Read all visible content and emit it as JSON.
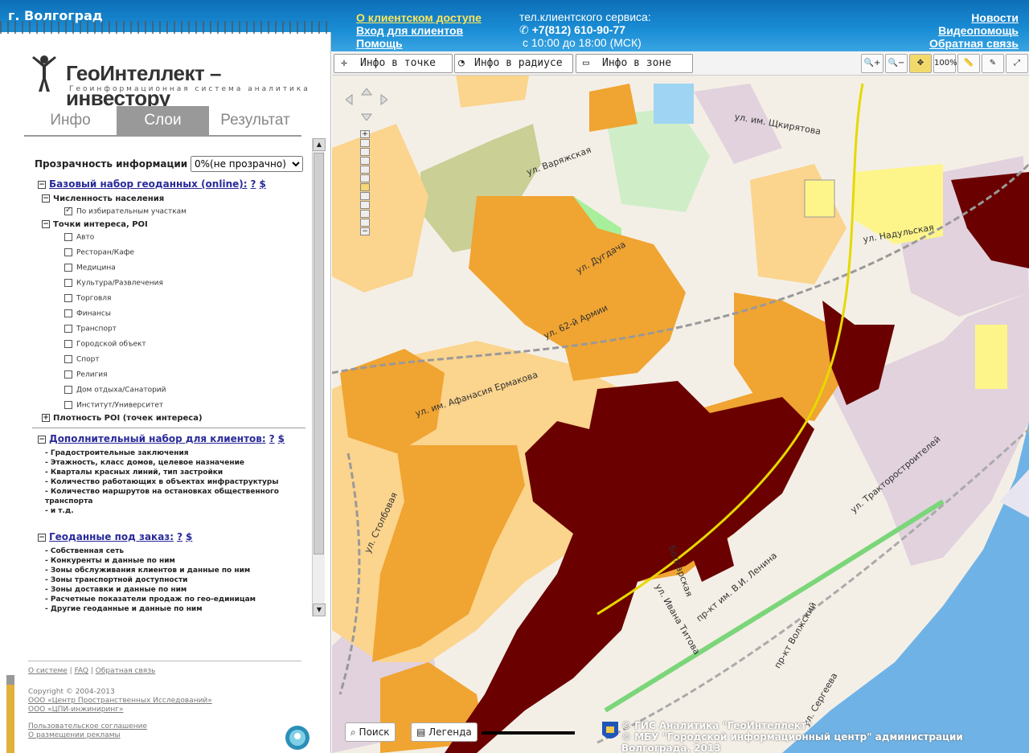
{
  "header": {
    "city": "г. Волгоград",
    "links_left": [
      "О клиентском доступе",
      "Вход для клиентов",
      "Помощь"
    ],
    "service_label": "тел.клиентского сервиса:",
    "phone": "+7(812) 610-90-77",
    "hours": "с 10:00 до 18:00 (МСК)",
    "links_right": [
      "Новости",
      "Видеопомощь",
      "Обратная связь"
    ]
  },
  "logo": {
    "title": "ГеоИнтеллект – инвестору",
    "subtitle": "Геоинформационная система аналитика"
  },
  "tabs": [
    "Инфо",
    "Слои",
    "Результат"
  ],
  "selected_tab": "Слои",
  "layers": {
    "transparency_label": "Прозрачность информации",
    "transparency_value": "0%(не прозрачно)",
    "base": {
      "title": "Базовый набор геоданных (online):",
      "q": "?",
      "cost": "$"
    },
    "population": "Численность населения",
    "by_districts": "По избирательным участкам",
    "poi": "Точки интереса, POI",
    "poi_items": [
      "Авто",
      "Ресторан/Кафе",
      "Медицина",
      "Культура/Развлечения",
      "Торговля",
      "Финансы",
      "Транспорт",
      "Городской объект",
      "Спорт",
      "Религия",
      "Дом отдыха/Санаторий",
      "Институт/Университет"
    ],
    "density": "Плотность POI (точек интереса)",
    "extra": {
      "title": "Дополнительный набор для клиентов:",
      "q": "?",
      "cost": "$"
    },
    "extra_items": [
      "- Градостроительные заключения",
      "- Этажность, класс домов, целевое назначение",
      "- Кварталы красных линий, тип застройки",
      "- Количество работающих в объектах инфраструктуры",
      "- Количество маршрутов на остановках общественного",
      "транспорта",
      "- и т.д."
    ],
    "order": {
      "title": "Геоданные под заказ:",
      "q": "?",
      "cost": "$"
    },
    "order_items": [
      "- Собственная сеть",
      "- Конкуренты и данные по ним",
      "- Зоны обслуживания клиентов и данные по ним",
      "- Зоны транспортной доступности",
      "- Зоны доставки и данные по ним",
      "- Расчетные показатели продаж по гео-единицам",
      "- Другие геоданные и данные по ним"
    ]
  },
  "footer": {
    "links": [
      "О системе",
      "FAQ",
      "Обратная связь"
    ],
    "copyright": "Copyright © 2004-2013",
    "org1": "ООО «Центр Пространственных Исследований»",
    "org2": "ООО «ЦПИ-инжиниринг»",
    "agreement": "Пользовательское соглашение",
    "ads": "О размещении рекламы"
  },
  "toolbar": {
    "point": "Инфо в точке",
    "radius": "Инфо в радиусе",
    "zone": "Инфо в зоне",
    "zoom_percent": "100%"
  },
  "bottom": {
    "search": "Поиск",
    "legend": "Легенда",
    "credit1": "© ГИС Аналитика \"ГеоИнтеллект\"",
    "credit2": "© МБУ \"Городской информационный центр\" администрации",
    "credit3": "Волгограда, 2013"
  },
  "streets": [
    "ул. им. Щкирятова",
    "ул. Дугдача",
    "ул. Надульская",
    "ул. им. Афанасия Ермакова",
    "ул. Столбовая",
    "пр-кт им. В.И. Ленина",
    "ул. Тракторостроителей",
    "пр-кт Волжский",
    "ул. Сергеева",
    "ул. Ивана Титова",
    "Болгарская",
    "ул. 62-й Армии",
    "ул. Варяжская"
  ],
  "colors": {
    "dark": "#6b0000",
    "orange": "#f0a431",
    "light_orange": "#fbd48d",
    "yellow": "#fdf58a",
    "river": "#6fb3e6",
    "purple": "#e1d2de",
    "green": "#a8ef9b"
  }
}
